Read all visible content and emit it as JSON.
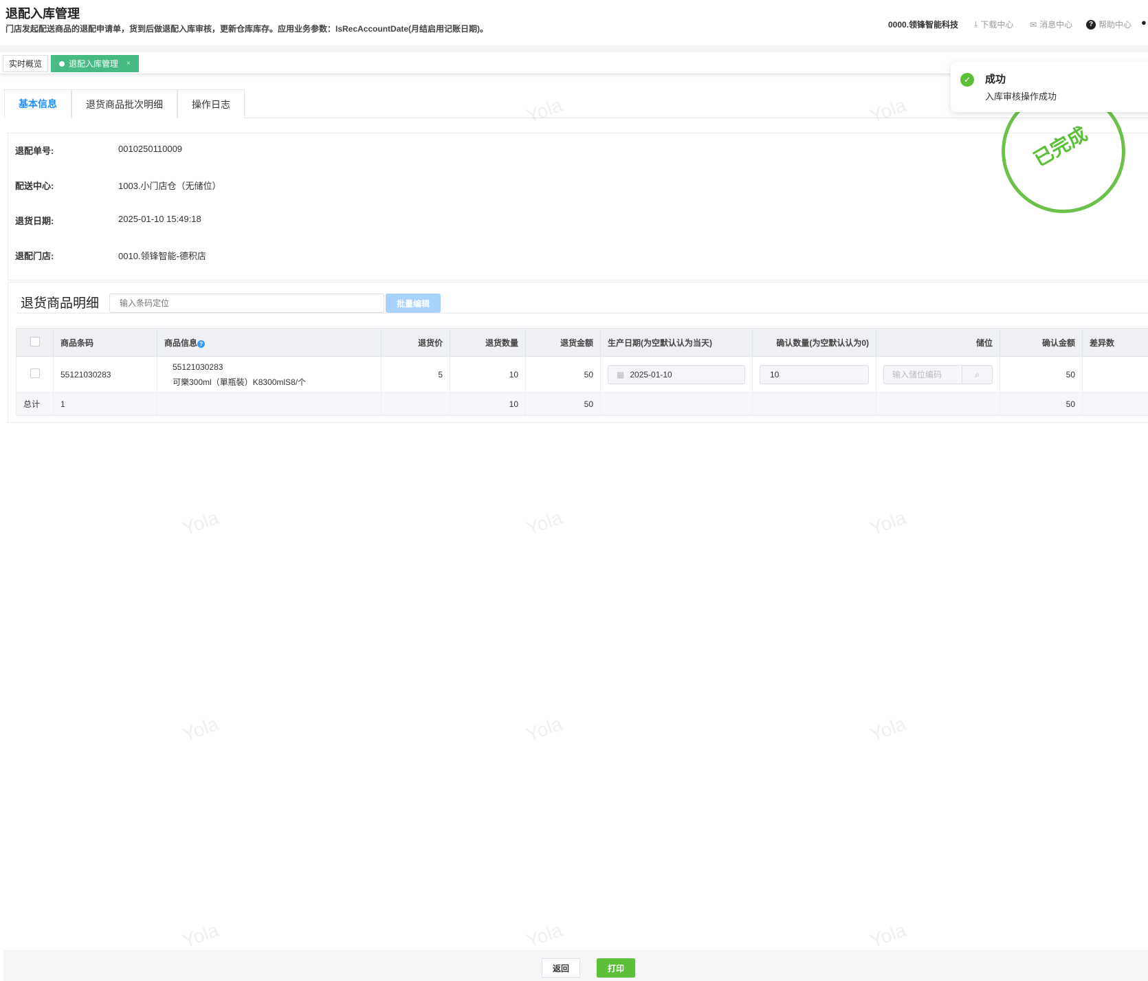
{
  "header": {
    "title": "退配入库管理",
    "description": "门店发起配送商品的退配申请单，货到后做退配入库审核，更新仓库库存。应用业务参数：IsRecAccountDate(月结启用记账日期)。",
    "company": "0000.领锋智能科技",
    "download": "下载中心",
    "messages": "消息中心",
    "help": "帮助中心"
  },
  "page_tabs": [
    {
      "label": "实时概览"
    },
    {
      "label": "退配入库管理",
      "close": "×"
    }
  ],
  "sub_tabs": [
    "基本信息",
    "退货商品批次明细",
    "操作日志"
  ],
  "info": [
    {
      "label": "退配单号:",
      "value": "0010250110009"
    },
    {
      "label": "配送中心:",
      "value": "1003.小门店仓（无储位）"
    },
    {
      "label": "退货日期:",
      "value": "2025-01-10 15:49:18"
    },
    {
      "label": "退配门店:",
      "value": "0010.领锋智能-德积店"
    }
  ],
  "stamp": "已完成",
  "toast": {
    "title": "成功",
    "message": "入库审核操作成功"
  },
  "detail": {
    "title": "退货商品明细",
    "search_placeholder": "输入条码定位",
    "batch_edit": "批量编辑"
  },
  "table": {
    "columns": [
      "商品条码",
      "商品信息",
      "退货价",
      "退货数量",
      "退货金额",
      "生产日期(为空默认认为当天)",
      "确认数量(为空默认认为0)",
      "储位",
      "确认金额",
      "差异数"
    ],
    "rows": [
      {
        "barcode": "55121030283",
        "info_code": "55121030283",
        "info_name": "可樂300ml（單瓶裝）K8300mlS8/个",
        "price": "5",
        "qty": "10",
        "amount": "50",
        "prod_date": "2025-01-10",
        "confirm_qty": "10",
        "location_placeholder": "输入储位编码",
        "confirm_amount": "50",
        "diff": ""
      }
    ],
    "total": {
      "label": "总计",
      "count": "1",
      "qty": "10",
      "amount": "50",
      "confirm_amount": "50"
    }
  },
  "footer": {
    "back": "返回",
    "print": "打印"
  },
  "watermark": "Yola",
  "colors": {
    "primary": "#1e90ff",
    "success": "#5cbf3a",
    "tab_active": "#48bb85"
  }
}
